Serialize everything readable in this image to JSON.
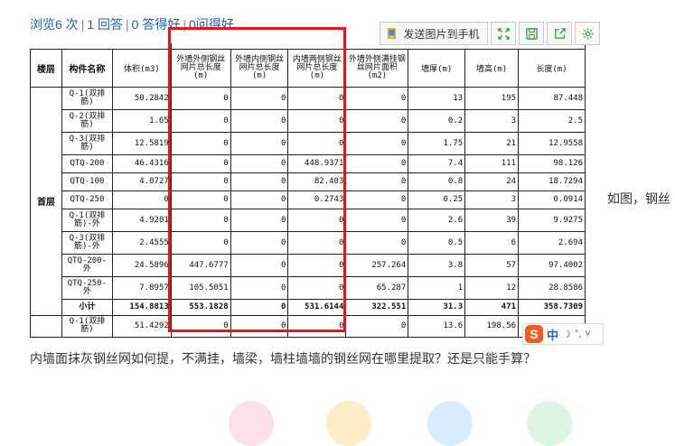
{
  "stats": {
    "views": "浏览6 次",
    "answers": "1 回答",
    "good_answers": "0 答得好",
    "good_questions": "0问得好"
  },
  "toolbar": {
    "send_label": "发送图片到手机",
    "icons": [
      "phone-image-icon",
      "expand-icon",
      "save-icon",
      "share-icon",
      "settings-icon"
    ]
  },
  "table": {
    "headers": {
      "floor": "楼层",
      "component": "构件名称",
      "volume": "体积(m3)",
      "col_a": "外墙外侧钢丝网片总长度(m)",
      "col_b": "外墙内侧钢丝网片总长度(m)",
      "col_c": "内墙两侧钢丝网片总长度(m)",
      "col_d": "外墙外侧满挂钢丝网片面积(m2)",
      "thickness": "墙厚(m)",
      "height": "墙高(m)",
      "length": "长度(m)"
    },
    "floor_name": "首层",
    "rows": [
      {
        "name": "Q-1(双排筋)",
        "v": "50.2842",
        "a": "0",
        "b": "0",
        "c": "0",
        "d": "0",
        "t": "13",
        "h": "195",
        "l": "87.448"
      },
      {
        "name": "Q-2(双排筋)",
        "v": "1.65",
        "a": "0",
        "b": "0",
        "c": "0",
        "d": "0",
        "t": "0.2",
        "h": "3",
        "l": "2.5"
      },
      {
        "name": "Q-3(双排筋)",
        "v": "12.5819",
        "a": "0",
        "b": "0",
        "c": "0",
        "d": "0",
        "t": "1.75",
        "h": "21",
        "l": "12.9558"
      },
      {
        "name": "QTQ-200",
        "v": "46.4316",
        "a": "0",
        "b": "0",
        "c": "448.9371",
        "d": "0",
        "t": "7.4",
        "h": "111",
        "l": "98.126"
      },
      {
        "name": "QTQ-100",
        "v": "4.0727",
        "a": "0",
        "b": "0",
        "c": "82.403",
        "d": "0",
        "t": "0.8",
        "h": "24",
        "l": "18.7294"
      },
      {
        "name": "QTQ-250",
        "v": "0",
        "a": "0",
        "b": "0",
        "c": "0.2743",
        "d": "0",
        "t": "0.25",
        "h": "3",
        "l": "0.0914"
      },
      {
        "name": "Q-1(双排筋)-外",
        "v": "4.9201",
        "a": "0",
        "b": "0",
        "c": "0",
        "d": "0",
        "t": "2.6",
        "h": "39",
        "l": "9.9275"
      },
      {
        "name": "Q-3(双排筋)-外",
        "v": "2.4555",
        "a": "0",
        "b": "0",
        "c": "0",
        "d": "0",
        "t": "0.5",
        "h": "6",
        "l": "2.694"
      },
      {
        "name": "QTQ-200-外",
        "v": "24.5896",
        "a": "447.6777",
        "b": "0",
        "c": "0",
        "d": "257.264",
        "t": "3.8",
        "h": "57",
        "l": "97.4002"
      },
      {
        "name": "QTQ-250-外",
        "v": "7.8957",
        "a": "105.5051",
        "b": "0",
        "c": "0",
        "d": "65.287",
        "t": "1",
        "h": "12",
        "l": "28.8586"
      }
    ],
    "total": {
      "name": "小计",
      "v": "154.8813",
      "a": "553.1828",
      "b": "0",
      "c": "531.6144",
      "d": "322.551",
      "t": "31.3",
      "h": "471",
      "l": "358.7309"
    },
    "next_row": {
      "name": "Q-1(双排筋)",
      "v": "51.4292",
      "a": "0",
      "b": "0",
      "c": "0",
      "d": "0",
      "t": "13.6",
      "h": "198.56",
      "l": ""
    }
  },
  "side_text": "如图，钢丝",
  "question": "内墙面抹灰钢丝网如何提，不满挂，墙梁，墙柱墙墙的钢丝网在哪里提取？还是只能手算？",
  "ime": {
    "logo": "S",
    "lang": "中"
  },
  "colors": {
    "link": "#1f5fae",
    "highlight": "#e8141b"
  }
}
